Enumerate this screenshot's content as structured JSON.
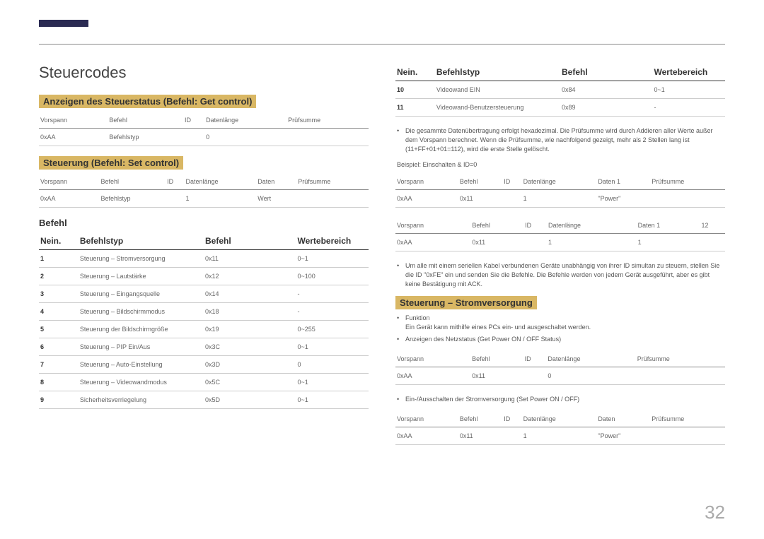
{
  "page_number": "32",
  "title": "Steuercodes",
  "sections": {
    "get_control": {
      "heading": "Anzeigen des Steuerstatus (Befehl: Get control)",
      "headers": [
        "Vorspann",
        "Befehl",
        "ID",
        "Datenlänge",
        "Prüfsumme"
      ],
      "row": [
        "0xAA",
        "Befehlstyp",
        "",
        "0",
        ""
      ]
    },
    "set_control": {
      "heading": "Steuerung (Befehl: Set control)",
      "headers": [
        "Vorspann",
        "Befehl",
        "ID",
        "Datenlänge",
        "Daten",
        "Prüfsumme"
      ],
      "row": [
        "0xAA",
        "Befehlstyp",
        "",
        "1",
        "Wert",
        ""
      ]
    },
    "befehl": {
      "heading": "Befehl",
      "columns": [
        "Nein.",
        "Befehlstyp",
        "Befehl",
        "Wertebereich"
      ],
      "rows_left": [
        [
          "1",
          "Steuerung – Stromversorgung",
          "0x11",
          "0~1"
        ],
        [
          "2",
          "Steuerung – Lautstärke",
          "0x12",
          "0~100"
        ],
        [
          "3",
          "Steuerung – Eingangsquelle",
          "0x14",
          "-"
        ],
        [
          "4",
          "Steuerung – Bildschirmmodus",
          "0x18",
          "-"
        ],
        [
          "5",
          "Steuerung der Bildschirmgröße",
          "0x19",
          "0~255"
        ],
        [
          "6",
          "Steuerung – PIP Ein/Aus",
          "0x3C",
          "0~1"
        ],
        [
          "7",
          "Steuerung – Auto-Einstellung",
          "0x3D",
          "0"
        ],
        [
          "8",
          "Steuerung – Videowandmodus",
          "0x5C",
          "0~1"
        ],
        [
          "9",
          "Sicherheitsverriegelung",
          "0x5D",
          "0~1"
        ]
      ],
      "rows_right": [
        [
          "10",
          "Videowand EIN",
          "0x84",
          "0~1"
        ],
        [
          "11",
          "Videowand-Benutzersteuerung",
          "0x89",
          "-"
        ]
      ]
    },
    "notes1": [
      "Die gesammte Datenübertragung erfolgt hexadezimal. Die Prüfsumme wird durch Addieren aller Werte außer dem Vorspann berechnet. Wenn die Prüfsumme, wie nachfolgend gezeigt, mehr als 2 Stellen lang ist (11+FF+01+01=112), wird die erste Stelle gelöscht."
    ],
    "example_label": "Beispiel: Einschalten & ID=0",
    "ex_table1": {
      "headers": [
        "Vorspann",
        "Befehl",
        "ID",
        "Datenlänge",
        "Daten 1",
        "Prüfsumme"
      ],
      "row": [
        "0xAA",
        "0x11",
        "",
        "1",
        "\"Power\"",
        ""
      ]
    },
    "ex_table2": {
      "headers": [
        "Vorspann",
        "Befehl",
        "ID",
        "Datenlänge",
        "Daten 1",
        "12"
      ],
      "row": [
        "0xAA",
        "0x11",
        "",
        "1",
        "1",
        ""
      ]
    },
    "notes2": [
      "Um alle mit einem seriellen Kabel verbundenen Geräte unabhängig von ihrer ID simultan zu steuern, stellen Sie die ID \"0xFE\" ein und senden Sie die Befehle. Die Befehle werden von jedem Gerät ausgeführt, aber es gibt keine Bestätigung mit ACK."
    ],
    "power": {
      "heading": "Steuerung – Stromversorgung",
      "bullets": [
        "Funktion\nEin Gerät kann mithilfe eines PCs ein- und ausgeschaltet werden.",
        "Anzeigen des Netzstatus (Get Power ON / OFF Status)"
      ],
      "t1_headers": [
        "Vorspann",
        "Befehl",
        "ID",
        "Datenlänge",
        "Prüfsumme"
      ],
      "t1_row": [
        "0xAA",
        "0x11",
        "",
        "0",
        ""
      ],
      "bullet3": "Ein-/Ausschalten der Stromversorgung (Set Power ON / OFF)",
      "t2_headers": [
        "Vorspann",
        "Befehl",
        "ID",
        "Datenlänge",
        "Daten",
        "Prüfsumme"
      ],
      "t2_row": [
        "0xAA",
        "0x11",
        "",
        "1",
        "\"Power\"",
        ""
      ]
    }
  }
}
